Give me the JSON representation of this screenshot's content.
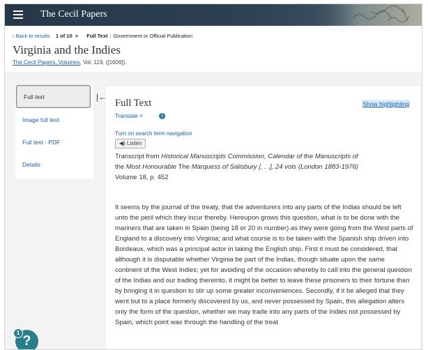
{
  "topbar": {
    "brand": "The Cecil Papers"
  },
  "breadcrumb": {
    "back": "Back to results",
    "position_prefix": "1",
    "position_suffix": "of 10",
    "next_arrow": ">",
    "doctype_label": "Full Text",
    "doctype_separator": "|",
    "doctype_value": "Government or Official Publication"
  },
  "document": {
    "title": "Virginia and the Indies",
    "source_link": "The Cecil Papers, Volumes",
    "source_rest": ", Vol. 119, ([1606])."
  },
  "sidebar": {
    "items": [
      {
        "label": "Full text"
      },
      {
        "label": "Image full text"
      },
      {
        "label": "Full text - PDF"
      },
      {
        "label": "Details"
      }
    ],
    "collapse_icon": "|←"
  },
  "content": {
    "heading": "Full Text",
    "show_highlighting": "Show highlighting",
    "translate": "Translate ˅",
    "info_icon": "i",
    "search_nav": "Turn on search term navigation",
    "listen": "◀) Listen",
    "transcript_prefix": "Transcript from ",
    "transcript_italic1": "Historical Manuscripts Commission, Calendar of",
    "transcript_mid1": " the ",
    "transcript_italic2": "Manuscripts of",
    "transcript_mid2": " the ",
    "transcript_italic3": "Most Honourable",
    "transcript_mid3": " The ",
    "transcript_italic4": "Marquess of Salisbury [. . .], 24 vols (London 1883-1976)",
    "transcript_vol": "Volume 18, p. 452",
    "body": "It seems by the journal of the treaty, that the adventurers into any parts of the Indias should be left unto the peril which they incur thereby. Hereupon grows this question, what is to be done with the mariners that are taken in Spain (being 18 or 20 in number) as they were going from the West parts of England to a discovery into Virginia; and what course is to be taken with the Spanish ship driven into Bordeaux, which was a principal actor in taking the English ship. First it must be considered, that although it is disputable whether Virginia be part of the Indias, though situate upon the same continent of the West Indies; yet for avoiding of the occasion whereby to call into the general question of the Indias and our trading thereinto, it might be better to leave these prisoners to their fortune than by bringing it in question to stir up some greater inconveniences. Secondly, if it be alleged that they went but to a place formerly discovered by us, and never possessed by Spain, this allegation alters only the form of the question, whether we may trade into any parts of the Indies not possessed by Spain, which point was through the handling of the treat"
  },
  "help": {
    "label": "?",
    "badge": "1"
  }
}
